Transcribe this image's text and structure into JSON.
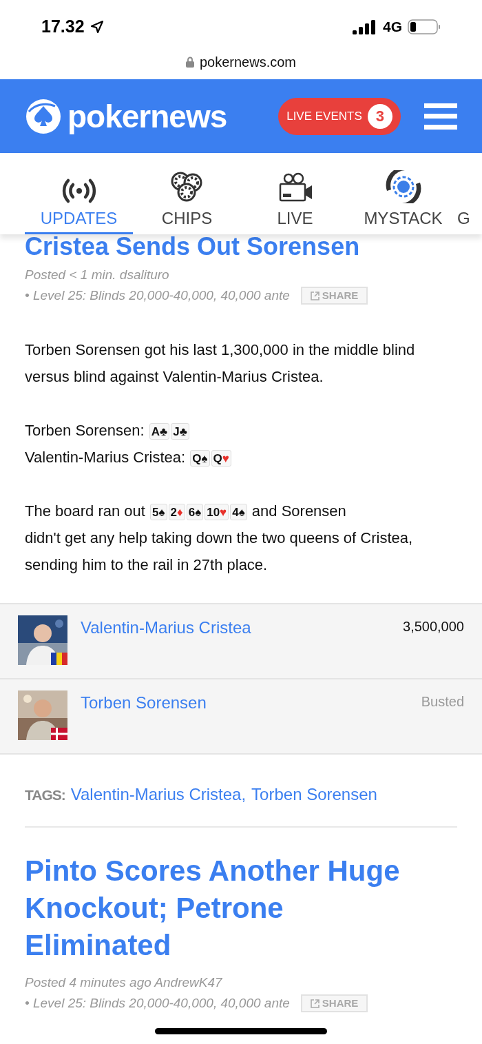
{
  "status_bar": {
    "time": "17.32",
    "network": "4G"
  },
  "browser": {
    "url": "pokernews.com"
  },
  "header": {
    "logo": "pokernews",
    "live_events": {
      "label": "LIVE EVENTS",
      "count": "3"
    }
  },
  "tabs": [
    {
      "label": "UPDATES",
      "kind": "broadcast",
      "selected": true
    },
    {
      "label": "CHIPS",
      "kind": "chips",
      "selected": false
    },
    {
      "label": "LIVE",
      "kind": "camera",
      "selected": false
    },
    {
      "label": "MYSTACK",
      "kind": "mystack",
      "selected": false
    },
    {
      "label": "G",
      "kind": "partial",
      "selected": false
    }
  ],
  "article": {
    "title": "Cristea Sends Out Sorensen",
    "posted": "Posted < 1 min. dsalituro",
    "level": "• Level 25: Blinds 20,000-40,000, 40,000 ante",
    "share": "SHARE",
    "intro": "Torben Sorensen got his last 1,300,000 in the middle blind versus blind against Valentin-Marius Cristea.",
    "hands": [
      {
        "player": "Torben Sorensen:",
        "cards": [
          {
            "rank": "A",
            "suit": "♣",
            "color": "#111111"
          },
          {
            "rank": "J",
            "suit": "♣",
            "color": "#111111"
          }
        ]
      },
      {
        "player": "Valentin-Marius Cristea:",
        "cards": [
          {
            "rank": "Q",
            "suit": "♠",
            "color": "#111111"
          },
          {
            "rank": "Q",
            "suit": "♥",
            "color": "#e8322b"
          }
        ]
      }
    ],
    "board_before": "The board ran out",
    "board": [
      {
        "rank": "5",
        "suit": "♠",
        "color": "#111111"
      },
      {
        "rank": "2",
        "suit": "♦",
        "color": "#e8322b"
      },
      {
        "rank": "6",
        "suit": "♠",
        "color": "#111111"
      },
      {
        "rank": "10",
        "suit": "♥",
        "color": "#e8322b"
      },
      {
        "rank": "4",
        "suit": "♠",
        "color": "#111111"
      }
    ],
    "board_after": "and Sorensen",
    "board_rest": "didn't get any help taking down the two queens of Cristea, sending him to the rail in 27th place.",
    "players": [
      {
        "name": "Valentin-Marius Cristea",
        "kind": "chips",
        "value": "3,500,000"
      },
      {
        "name": "Torben Sorensen",
        "kind": "busted",
        "value": "Busted"
      }
    ],
    "tags_label": "TAGS:",
    "tags": [
      "Valentin-Marius Cristea,",
      "Torben Sorensen"
    ]
  },
  "next_article": {
    "title": "Pinto Scores Another Huge Knockout; Petrone Eliminated",
    "posted": "Posted 4 minutes ago AndrewK47",
    "level": "• Level 25: Blinds 20,000-40,000, 40,000 ante",
    "share": "SHARE"
  }
}
